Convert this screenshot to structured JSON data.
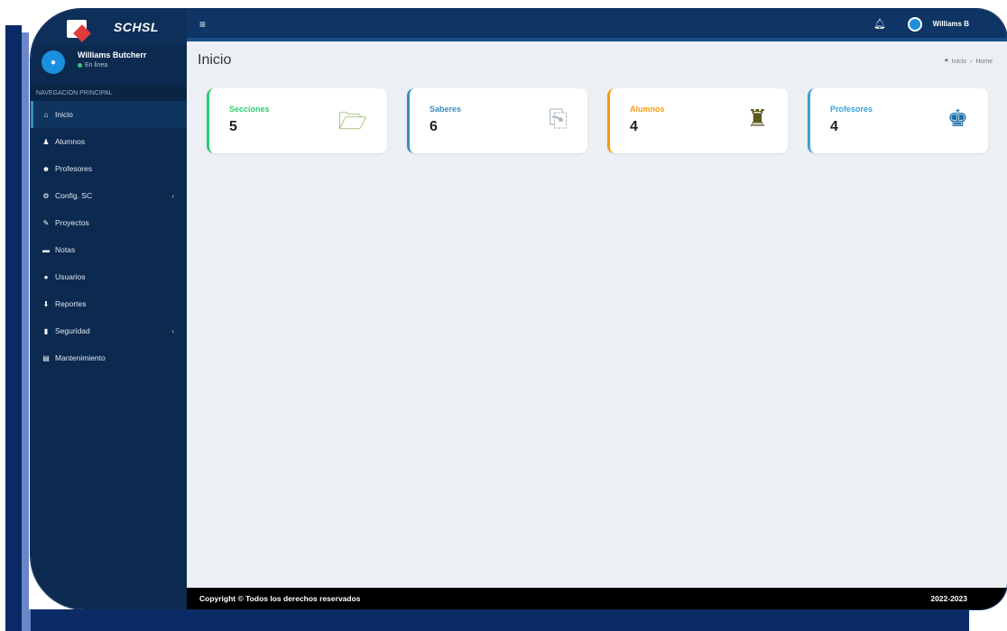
{
  "app": {
    "brand": "SCHSL"
  },
  "user": {
    "name": "Williams Butcherr",
    "status": "En linea",
    "topbar_name": "Williams B"
  },
  "nav": {
    "header": "NAVEGACION PRINCIPAL",
    "items": [
      {
        "label": "Inicio",
        "icon": "home-icon",
        "glyph": "⌂",
        "active": true
      },
      {
        "label": "Alumnos",
        "icon": "user-icon",
        "glyph": "♟"
      },
      {
        "label": "Profesores",
        "icon": "users-icon",
        "glyph": "☻"
      },
      {
        "label": "Config. SC",
        "icon": "cogs-icon",
        "glyph": "⚙",
        "caret": "‹"
      },
      {
        "label": "Proyectos",
        "icon": "pencil-icon",
        "glyph": "✎"
      },
      {
        "label": "Notas",
        "icon": "graduation-cap-icon",
        "glyph": "▬"
      },
      {
        "label": "Usuarios",
        "icon": "user-circle-icon",
        "glyph": "●"
      },
      {
        "label": "Reportes",
        "icon": "download-icon",
        "glyph": "⬇"
      },
      {
        "label": "Seguridad",
        "icon": "lock-icon",
        "glyph": "▮",
        "caret": "‹"
      },
      {
        "label": "Mantenimiento",
        "icon": "database-icon",
        "glyph": "▤"
      }
    ]
  },
  "topbar": {
    "menu_glyph": "≡",
    "bell_glyph": "♫"
  },
  "page": {
    "title": "Inicio",
    "breadcrumb_home": "Inicio",
    "breadcrumb_sep": "›",
    "breadcrumb_current": "Home"
  },
  "cards": [
    {
      "label": "Secciones",
      "value": "5",
      "icon": "folder-open-icon",
      "glyph": "🗁",
      "color": "#2ecc71",
      "icon_color": "#7aa640"
    },
    {
      "label": "Saberes",
      "value": "6",
      "icon": "copy-icon",
      "glyph": "⎘",
      "color": "#3c8dbc",
      "icon_color": "#a9b3bf"
    },
    {
      "label": "Alumnos",
      "value": "4",
      "icon": "graduate-icon",
      "glyph": "♜",
      "color": "#f39c12",
      "icon_color": "#5b5a1c"
    },
    {
      "label": "Profesores",
      "value": "4",
      "icon": "user-tie-icon",
      "glyph": "♚",
      "color": "#3aa0d5",
      "icon_color": "#1e6fa7"
    }
  ],
  "footer": {
    "copyright": "Copyright © Todos los derechos reservados",
    "years": "2022-2023"
  },
  "colors": {
    "sidebar": "#0c2a4f",
    "topbar": "#0e3566",
    "content_bg": "#ecf0f5",
    "footer": "#000000"
  }
}
